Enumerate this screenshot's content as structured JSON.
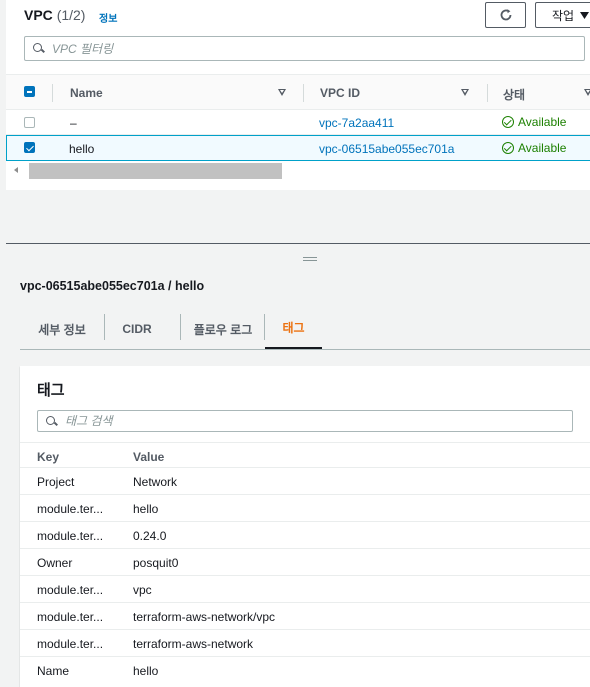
{
  "header": {
    "title": "VPC",
    "count": "(1/2)",
    "info_link": "정보",
    "action_button": "작업"
  },
  "filter": {
    "placeholder": "VPC 필터링"
  },
  "vpc_table": {
    "columns": [
      "Name",
      "VPC ID",
      "상태"
    ],
    "rows": [
      {
        "name": "–",
        "vpc_id": "vpc-7a2aa411",
        "status": "Available",
        "selected": false
      },
      {
        "name": "hello",
        "vpc_id": "vpc-06515abe055ec701a",
        "status": "Available",
        "selected": true
      }
    ]
  },
  "detail": {
    "title": "vpc-06515abe055ec701a / hello",
    "tabs": [
      "세부 정보",
      "CIDR",
      "플로우 로그",
      "태그"
    ],
    "active_tab": "태그"
  },
  "tags": {
    "title": "태그",
    "search_placeholder": "태그 검색",
    "columns": [
      "Key",
      "Value"
    ],
    "rows": [
      {
        "key": "Project",
        "value": "Network"
      },
      {
        "key": "module.ter...",
        "value": "hello"
      },
      {
        "key": "module.ter...",
        "value": "0.24.0"
      },
      {
        "key": "Owner",
        "value": "posquit0"
      },
      {
        "key": "module.ter...",
        "value": "vpc"
      },
      {
        "key": "module.ter...",
        "value": "terraform-aws-network/vpc"
      },
      {
        "key": "module.ter...",
        "value": "terraform-aws-network"
      },
      {
        "key": "Name",
        "value": "hello"
      }
    ]
  },
  "colors": {
    "accent": "#0073bb",
    "success": "#1d8102",
    "active_tab": "#ec7211"
  },
  "icons": [
    "refresh-icon",
    "caret-down-icon",
    "search-icon",
    "sort-icon",
    "status-ok-icon",
    "scroll-left-icon",
    "resize-grip-icon"
  ]
}
